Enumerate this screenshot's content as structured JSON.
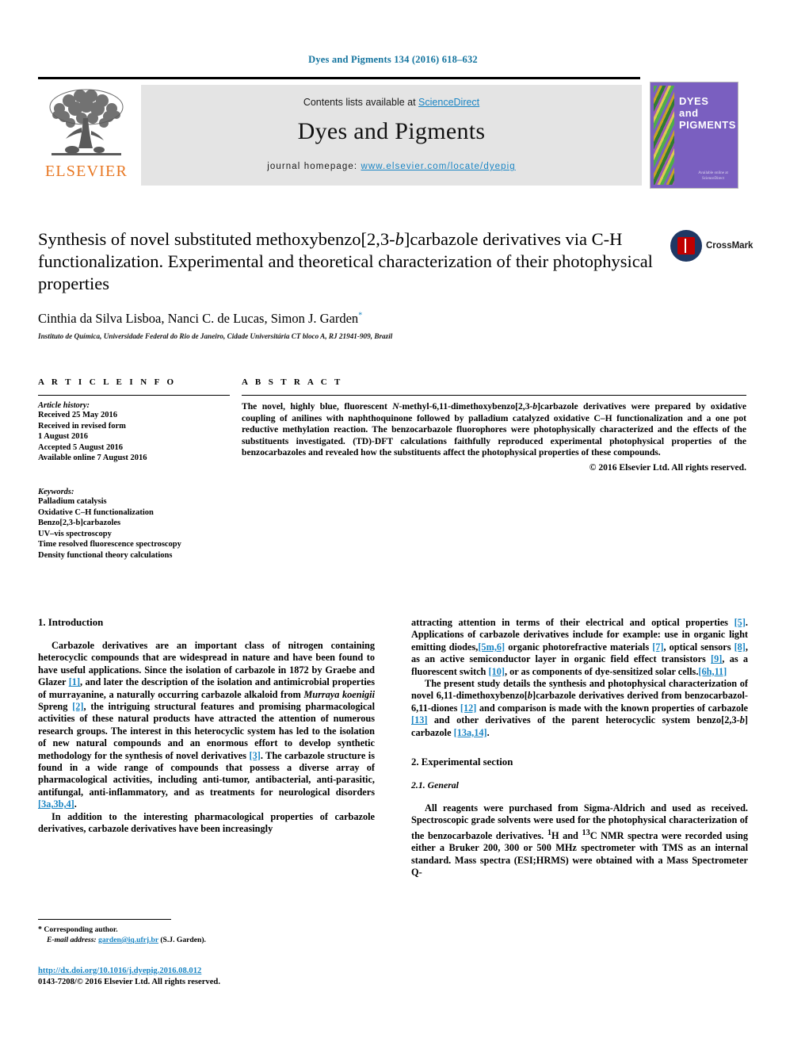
{
  "running_head": "Dyes and Pigments 134 (2016) 618–632",
  "masthead": {
    "contents_prefix": "Contents lists available at ",
    "sciencedirect": "ScienceDirect",
    "journal_title": "Dyes and Pigments",
    "homepage_label": "journal homepage: ",
    "homepage_url": "www.elsevier.com/locate/dyepig",
    "publisher_wordmark": "ELSEVIER",
    "publisher_icon": "elsevier-tree-icon",
    "cover": {
      "line1": "DYES",
      "line2": "and",
      "line3": "PIGMENTS",
      "footer": "Available online at ScienceDirect",
      "bg_color": "#7a5fc0"
    }
  },
  "crossmark": {
    "label": "CrossMark",
    "icon": "crossmark-icon",
    "circle_color": "#1f3864",
    "book_color": "#c00000"
  },
  "title": {
    "line1_a": "Synthesis of novel substituted methoxybenzo[2,3-",
    "line1_italic": "b",
    "line1_b": "]carbazole",
    "line2": "derivatives via C-H functionalization. Experimental and theoretical",
    "line3": "characterization of their photophysical properties"
  },
  "authors": {
    "names": "Cinthia da Silva Lisboa, Nanci C. de Lucas, Simon J. Garden",
    "corresponding_marker": "*",
    "affiliation": "Instituto de Química, Universidade Federal do Rio de Janeiro, Cidade Universitária CT bloco A, RJ 21941-909, Brazil"
  },
  "article_info": {
    "heading": "A R T I C L E  I N F O",
    "history_label": "Article history:",
    "history": [
      "Received 25 May 2016",
      "Received in revised form",
      "1 August 2016",
      "Accepted 5 August 2016",
      "Available online 7 August 2016"
    ],
    "keywords_label": "Keywords:",
    "keywords": [
      "Palladium catalysis",
      "Oxidative C–H functionalization",
      "Benzo[2,3-b]carbazoles",
      "UV–vis spectroscopy",
      "Time resolved fluorescence spectroscopy",
      "Density functional theory calculations"
    ]
  },
  "abstract": {
    "heading": "A B S T R A C T",
    "text_a": "The novel, highly blue, fluorescent ",
    "text_italic_n": "N",
    "text_b": "-methyl-6,11-dimethoxybenzo[2,3-",
    "text_italic_b": "b",
    "text_c": "]carbazole derivatives were prepared by oxidative coupling of anilines with naphthoquinone followed by palladium catalyzed oxidative C–H functionalization and a one pot reductive methylation reaction. The benzocarbazole fluorophores were photophysically characterized and the effects of the substituents investigated. (TD)-DFT calculations faithfully reproduced experimental photophysical properties of the benzocarbazoles and revealed how the substituents affect the photophysical properties of these compounds.",
    "copyright": "© 2016 Elsevier Ltd. All rights reserved."
  },
  "sections": {
    "introduction_heading": "1.  Introduction",
    "experimental_heading": "2.  Experimental section",
    "general_heading": "2.1.  General"
  },
  "body": {
    "intro_p1_a": "Carbazole derivatives are an important class of nitrogen containing heterocyclic compounds that are widespread in nature and have been found to have useful applications. Since the isolation of carbazole in 1872 by Graebe and Glazer ",
    "intro_p1_cit1": "[1]",
    "intro_p1_b": ", and later the description of the isolation and antimicrobial properties of murrayanine, a naturally occurring carbazole alkaloid from ",
    "intro_p1_italic": "Murraya koenigii",
    "intro_p1_c": " Spreng ",
    "intro_p1_cit2": "[2]",
    "intro_p1_d": ", the intriguing structural features and promising pharmacological activities of these natural products have attracted the attention of numerous research groups. The interest in this heterocyclic system has led to the isolation of new natural compounds and an enormous effort to develop synthetic methodology for the synthesis of novel derivatives ",
    "intro_p1_cit3": "[3]",
    "intro_p1_e": ". The carbazole structure is found in a wide range of compounds that possess a diverse array of pharmacological activities, including anti-tumor, antibacterial, anti-parasitic, antifungal, anti-inflammatory, and as treatments for neurological disorders ",
    "intro_p1_cit4": "[3a,3b,4]",
    "intro_p1_f": ".",
    "intro_p2": "In addition to the interesting pharmacological properties of carbazole derivatives, carbazole derivatives have been increasingly",
    "intro_p2_cont_a": "attracting attention in terms of their electrical and optical properties ",
    "intro_p2_cont_cit5": "[5]",
    "intro_p2_cont_b": ". Applications of carbazole derivatives include for example: use in organic light emitting diodes,",
    "intro_p2_cont_cit6": "[5m,6]",
    "intro_p2_cont_c": " organic photorefractive materials ",
    "intro_p2_cont_cit7": "[7]",
    "intro_p2_cont_d": ", optical sensors ",
    "intro_p2_cont_cit8": "[8]",
    "intro_p2_cont_e": ", as an active semiconductor layer in organic field effect transistors ",
    "intro_p2_cont_cit9": "[9]",
    "intro_p2_cont_f": ", as a fluorescent switch ",
    "intro_p2_cont_cit10": "[10]",
    "intro_p2_cont_g": ", or as components of dye-sensitized solar cells.",
    "intro_p2_cont_cit11": "[6h,11]",
    "intro_p3_a": "The present study details the synthesis and photophysical characterization of novel 6,11-dimethoxybenzo[",
    "intro_p3_italic1": "b",
    "intro_p3_b": "]carbazole derivatives derived from benzocarbazol-6,11-diones ",
    "intro_p3_cit12": "[12]",
    "intro_p3_c": " and comparison is made with the known properties of carbazole ",
    "intro_p3_cit13": "[13]",
    "intro_p3_d": " and other derivatives of the parent heterocyclic system benzo[2,3-",
    "intro_p3_italic2": "b",
    "intro_p3_e": "] carbazole ",
    "intro_p3_cit14": "[13a,14]",
    "intro_p3_f": ".",
    "general_p_a": "All reagents were purchased from Sigma-Aldrich and used as received. Spectroscopic grade solvents were used for the photophysical characterization of the benzocarbazole derivatives. ",
    "general_sup1": "1",
    "general_p_b": "H and ",
    "general_sup13": "13",
    "general_p_c": "C NMR spectra were recorded using either a Bruker 200, 300 or 500 MHz spectrometer with TMS as an internal standard. Mass spectra (ESI;HRMS) were obtained with a Mass Spectrometer Q-"
  },
  "footer": {
    "corresponding_star": "*",
    "corresponding_label": " Corresponding author.",
    "email_label": "E-mail address: ",
    "email": "garden@iq.ufrj.br",
    "email_suffix": " (S.J. Garden).",
    "doi_url": "http://dx.doi.org/10.1016/j.dyepig.2016.08.012",
    "issn_line": "0143-7208/© 2016 Elsevier Ltd. All rights reserved."
  },
  "colors": {
    "link_blue": "#1a85c4",
    "elsevier_orange": "#e87722",
    "band_gray": "#e4e4e4"
  }
}
